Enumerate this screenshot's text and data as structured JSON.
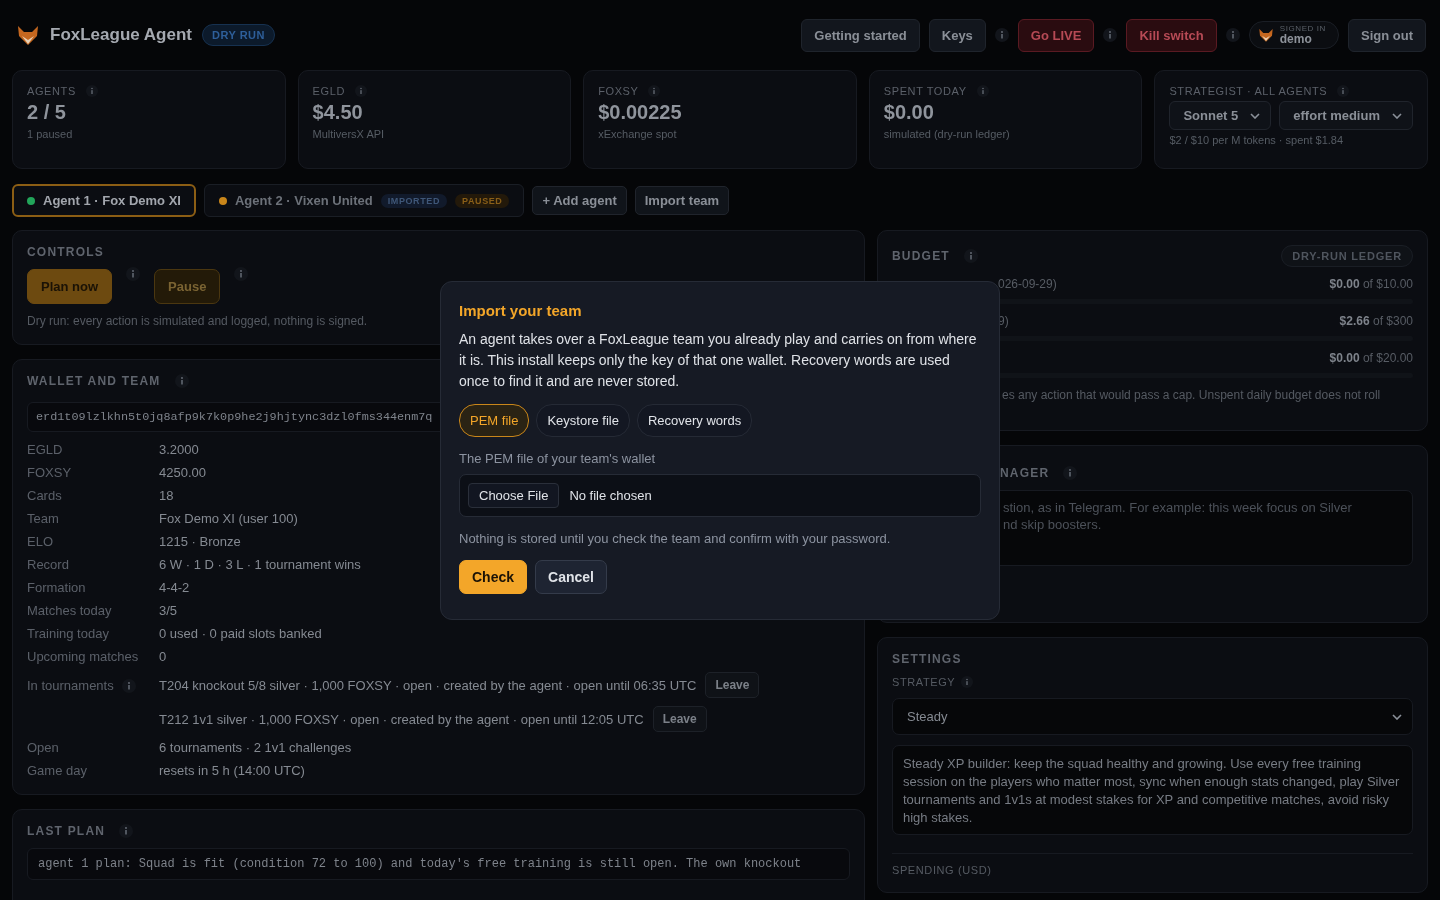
{
  "header": {
    "title": "FoxLeague Agent",
    "mode_badge": "DRY RUN",
    "buttons": [
      {
        "label": "Getting started",
        "kind": "plain"
      },
      {
        "label": "Keys",
        "kind": "plain"
      },
      {
        "kind": "info"
      },
      {
        "label": "Go LIVE",
        "kind": "danger"
      },
      {
        "kind": "info"
      },
      {
        "label": "Kill switch",
        "kind": "danger"
      },
      {
        "kind": "info"
      }
    ],
    "user": {
      "caption": "SIGNED IN",
      "name": "demo"
    },
    "sign_out": "Sign out"
  },
  "stats": [
    {
      "label": "AGENTS",
      "value": "2 / 5",
      "sub": "1 paused"
    },
    {
      "label": "EGLD",
      "value": "$4.50",
      "sub": "MultiversX API"
    },
    {
      "label": "FOXSY",
      "value": "$0.00225",
      "sub": "xExchange spot"
    },
    {
      "label": "SPENT TODAY",
      "value": "$0.00",
      "sub": "simulated (dry-run ledger)"
    }
  ],
  "strategist": {
    "label": "STRATEGIST · ALL AGENTS",
    "selects": [
      "Sonnet 5",
      "effort medium"
    ],
    "sub": "$2 / $10 per M tokens · spent $1.84"
  },
  "agents": [
    {
      "label": "Agent 1 · Fox Demo XI",
      "color": "#22a55a",
      "selected": true
    },
    {
      "label": "Agent 2 · Vixen United",
      "color": "#c9861a",
      "selected": false,
      "badges": [
        {
          "text": "IMPORTED",
          "kind": "info"
        },
        {
          "text": "PAUSED",
          "kind": "warn"
        }
      ]
    }
  ],
  "agent_actions": [
    "+ Add agent",
    "Import team"
  ],
  "controls": {
    "title": "CONTROLS",
    "buttons": [
      {
        "label": "Plan now",
        "kind": "primary"
      },
      {
        "label": "Pause",
        "kind": "secondary"
      }
    ],
    "note": "Dry run: every action is simulated and logged, nothing is signed."
  },
  "wallet": {
    "title": "WALLET AND TEAM",
    "address": "erd1t09lzlkhn5t0jq8afp9k7k0p9he2j9hjtync3dzl0fms344enm7q",
    "rows": [
      {
        "label": "EGLD",
        "value": "3.2000"
      },
      {
        "label": "FOXSY",
        "value": "4250.00"
      },
      {
        "label": "Cards",
        "value": "18"
      },
      {
        "label": "Team",
        "value": "Fox Demo XI (user 100)"
      },
      {
        "label": "ELO",
        "value": "1215 · Bronze"
      },
      {
        "label": "Record",
        "value": "6 W · 1 D · 3 L · 1 tournament wins"
      },
      {
        "label": "Formation",
        "value": "4-4-2"
      },
      {
        "label": "Matches today",
        "value": "3/5"
      },
      {
        "label": "Training today",
        "value": "0 used · 0 paid slots banked"
      },
      {
        "label": "Upcoming matches",
        "value": "0"
      }
    ],
    "tournaments": {
      "label": "In tournaments",
      "entries": [
        {
          "text": "T204 knockout 5/8 silver · 1,000 FOXSY · open · created by the agent · open until 06:35 UTC",
          "action": "Leave"
        },
        {
          "text": "T212 1v1 silver · 1,000 FOXSY · open · created by the agent · open until 12:05 UTC",
          "action": "Leave"
        }
      ]
    },
    "rows_after": [
      {
        "label": "Open",
        "value": "6 tournaments · 2 1v1 challenges"
      },
      {
        "label": "Game day",
        "value": "resets in 5 h (14:00 UTC)"
      }
    ]
  },
  "last_plan": {
    "title": "LAST PLAN",
    "text": "agent 1 plan: Squad is fit (condition 72 to 100) and today's free training is still open. The own knockout"
  },
  "budget": {
    "title": "BUDGET",
    "badge": "DRY-RUN LEDGER",
    "rows": [
      {
        "label": "026-09-29)",
        "spent": "$0.00",
        "cap": "of $10.00",
        "level": 0
      },
      {
        "label": "9)",
        "spent": "$2.66",
        "cap": "of $300",
        "level": 0.01
      },
      {
        "spent": "$0.00",
        "cap": "of $20.00",
        "level": 0
      }
    ],
    "note": "es any action that would pass a cap. Unspent daily budget does not roll"
  },
  "manager": {
    "title": "NAGER",
    "placeholder": [
      "stion, as in Telegram. For example: this week focus on Silver",
      "nd skip boosters."
    ]
  },
  "settings": {
    "title": "SETTINGS",
    "strategy_label": "STRATEGY",
    "strategy": "Steady",
    "description": "Steady XP builder: keep the squad healthy and growing. Use every free training session on the players who matter most, sync when enough stats changed, play Silver tournaments and 1v1s at modest stakes for XP and competitive matches, avoid risky high stakes.",
    "spending_label": "SPENDING (USD)"
  },
  "modal": {
    "title": "Import your team",
    "text": "An agent takes over a FoxLeague team you already play and carries on from where it is. This install keeps only the key of that one wallet. Recovery words are used once to find it and are never stored.",
    "methods": [
      {
        "label": "PEM file",
        "selected": true
      },
      {
        "label": "Keystore file",
        "selected": false
      },
      {
        "label": "Recovery words",
        "selected": false
      }
    ],
    "field_label": "The PEM file of your team's wallet",
    "file_button": "Choose File",
    "file_status": "No file chosen",
    "note": "Nothing is stored until you check the team and confirm with your password.",
    "buttons": [
      {
        "label": "Check",
        "kind": "primary"
      },
      {
        "label": "Cancel",
        "kind": "secondary"
      }
    ]
  }
}
